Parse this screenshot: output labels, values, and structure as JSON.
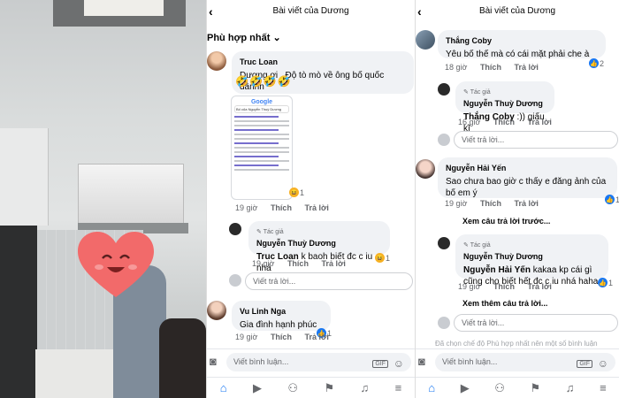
{
  "panel2": {
    "header_title": "Bài viết của Dương",
    "filter_label": "Phù hợp nhất",
    "filter_icon": "chevron-down-icon",
    "comments": [
      {
        "name": "Truc Loan",
        "text": "Dương ơi . Độ tò mò về ông bố quốc dânnn",
        "emojis": "🤣🤣🤣🤣",
        "time": "19 giờ",
        "like": "Thích",
        "reply": "Trả lời",
        "reaction_count": "1"
      },
      {
        "name": "Vu Linh Nga",
        "text": "Gia đình hạnh phúc",
        "time": "19 giờ",
        "like": "Thích",
        "reply": "Trả lời",
        "reaction_count": "1"
      }
    ],
    "reply": {
      "author_tag": "Tác giả",
      "name": "Nguyễn Thuỳ Dương",
      "mention": "Truc Loan",
      "text": " k baoh biết đc c iu nhá",
      "time": "19 giờ",
      "like": "Thích",
      "reply": "Trả lời",
      "reaction_count": "1"
    },
    "google_shot": {
      "logo": "Google",
      "query": "Bố của Nguyễn Thuỳ Dương"
    },
    "reply_placeholder": "Viết trả lời...",
    "comment_placeholder": "Viết bình luận...",
    "gif_label": "GIF"
  },
  "panel3": {
    "header_title": "Bài viết của Dương",
    "comments": [
      {
        "name": "Thắng Coby",
        "text": "Yêu bố thế mà có cái mặt phải che à",
        "time": "18 giờ",
        "like": "Thích",
        "reply": "Trả lời",
        "reaction_count": "2"
      },
      {
        "name": "Nguyễn Hải Yến",
        "text": "Sao chưa bao giờ c thấy e đăng ảnh của bố em ý",
        "time": "19 giờ",
        "like": "Thích",
        "reply": "Trả lời",
        "reaction_count": "1"
      }
    ],
    "replies": [
      {
        "author_tag": "Tác giả",
        "name": "Nguyễn Thuỳ Dương",
        "mention": "Thắng Coby",
        "text": " :)) giấu kĩ",
        "time": "16 giờ",
        "like": "Thích",
        "reply": "Trả lời"
      },
      {
        "author_tag": "Tác giả",
        "name": "Nguyễn Thuỳ Dương",
        "mention": "Nguyễn Hải Yến",
        "text": " kakaa kp cái gì cũng cho biết hết đc c iu nhá haha",
        "time": "19 giờ",
        "like": "Thích",
        "reply": "Trả lời",
        "reaction_count": "1"
      }
    ],
    "view_previous": "Xem câu trả lời trước...",
    "view_more": "Xem thêm câu trả lời...",
    "faded_text": "Đã chọn chế độ Phù hợp nhất nên một số bình luận",
    "reply_placeholder": "Viết trả lời...",
    "comment_placeholder": "Viết bình luận...",
    "gif_label": "GIF"
  },
  "nav_icons": [
    "home-icon",
    "video-icon",
    "groups-icon",
    "flag-icon",
    "bell-icon",
    "menu-icon"
  ]
}
